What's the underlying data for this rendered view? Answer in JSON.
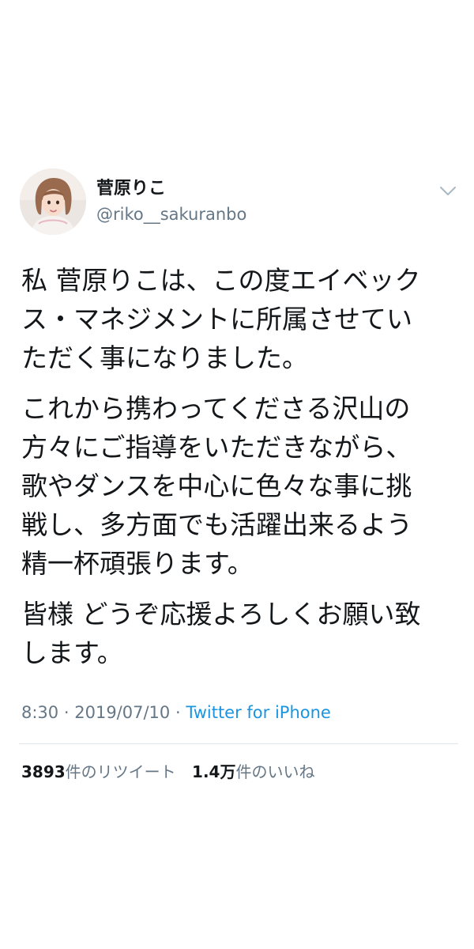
{
  "user": {
    "display_name": "菅原りこ",
    "handle": "@riko__sakuranbo"
  },
  "tweet": {
    "paragraphs": [
      "私 菅原りこは、この度エイベック\nス・マネジメントに所属させてい\nただく事になりました。",
      "これから携わってくださる沢山の\n方々にご指導をいただきながら、\n歌やダンスを中心に色々な事に挑\n戦し、多方面でも活躍出来るよう\n精一杯頑張ります。",
      "皆様 どうぞ応援よろしくお願い致\nします。"
    ],
    "time": "8:30",
    "separator": "·",
    "date": "2019/07/10",
    "source": "Twitter for iPhone"
  },
  "stats": {
    "retweets_count": "3893",
    "retweets_label": "件のリツイート",
    "likes_count": "1.4万",
    "likes_label": "件のいいね"
  },
  "icons": {
    "caret": "chevron-down-icon"
  },
  "colors": {
    "text": "#14171a",
    "secondary": "#657786",
    "link": "#1b95e0",
    "divider": "#e1e8ed"
  }
}
